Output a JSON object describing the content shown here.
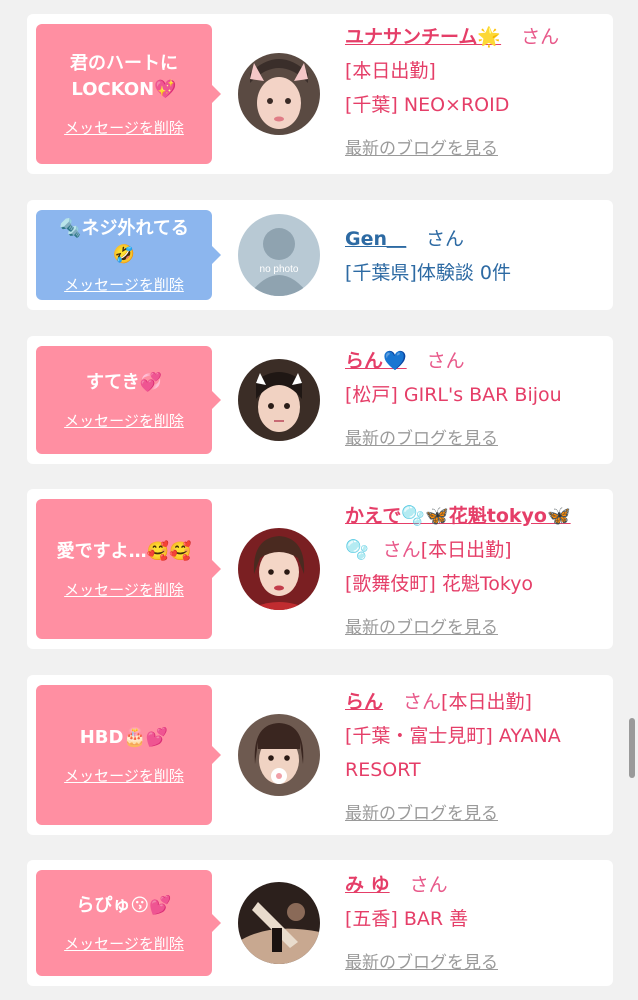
{
  "delete_label": "メッセージを削除",
  "blog_label": "最新のブログを見る",
  "san_label": "さん",
  "messages": [
    {
      "text1": "君のハートに",
      "text2": "LOCKON💖",
      "name": "ユナサンチーム🌟",
      "detail1": "[本日出勤]",
      "detail2": "[千葉] NEO×ROID"
    },
    {
      "text1": "🔩ネジ外れてる",
      "text2": "🤣",
      "name": "Gen＿",
      "detail1": "[千葉県]体験談 0件",
      "avatar_text": "no photo"
    },
    {
      "text1": "すてき💞",
      "name": "らん💙",
      "detail1": "[松戸] GIRL's BAR Bijou"
    },
    {
      "text1": "愛ですよ…🥰🥰",
      "name": "かえで🫧🦋花魁tokyo🦋",
      "name2": "🫧",
      "detail1": "[本日出勤]",
      "detail2": "[歌舞伎町] 花魁Tokyo"
    },
    {
      "text1": "HBD🎂💕",
      "name": "らん",
      "detail1": "[本日出勤]",
      "detail2": "[千葉・富士見町] AYANA",
      "detail3": "RESORT"
    },
    {
      "text1": "らぴゅ😗💕",
      "name": "み ゆ",
      "detail1": "[五香] BAR 善"
    }
  ],
  "colors": {
    "pink_bubble": "#ff8fa2",
    "blue_bubble": "#8cb6ee",
    "name_pink": "#e53e68",
    "name_blue": "#2d6aa3",
    "blog_gray": "#9a9a9a"
  }
}
